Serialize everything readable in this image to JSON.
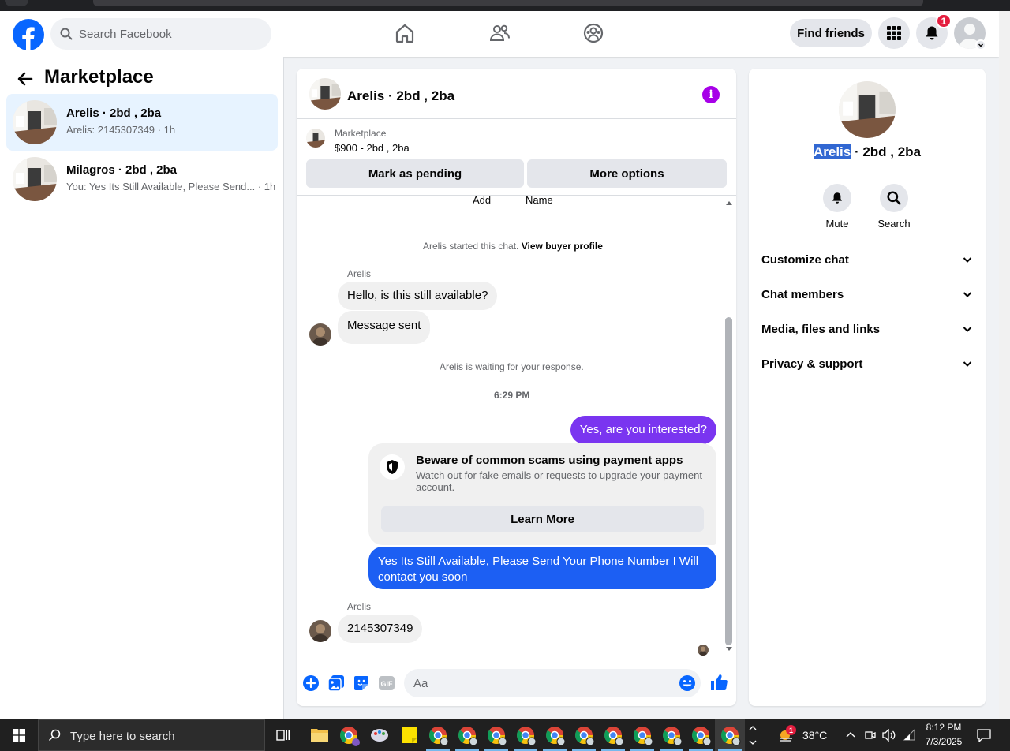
{
  "topnav": {
    "search_placeholder": "Search Facebook",
    "find_friends": "Find friends",
    "notification_count": "1"
  },
  "left_panel": {
    "title": "Marketplace",
    "conversations": [
      {
        "name": "Arelis · 2bd , 2ba",
        "snippet": "Arelis: 2145307349 · 1h",
        "active": true
      },
      {
        "name": "Milagros · 2bd , 2ba",
        "snippet": "You: Yes Its Still Available, Please Send... · 1h",
        "active": false
      }
    ]
  },
  "chat": {
    "title": "Arelis · 2bd , 2ba",
    "listing_label": "Marketplace",
    "listing_price": "$900 - 2bd , 2ba",
    "mark_pending": "Mark as pending",
    "more_options": "More options",
    "cut_labels": [
      "Add",
      "Name"
    ],
    "started_text": "Arelis started this chat.",
    "view_buyer": "View buyer profile",
    "sender_1": "Arelis",
    "msg_1": "Hello, is this still available?",
    "msg_2": "Message sent",
    "waiting_text": "Arelis is waiting for your response.",
    "timestamp": "6:29 PM",
    "out_1": "Yes, are you interested?",
    "scam_title": "Beware of common scams using payment apps",
    "scam_body": "Watch out for fake emails or requests to upgrade your payment account.",
    "learn_more": "Learn More",
    "out_2": "Yes Its Still Available, Please Send Your Phone Number I Will contact you soon",
    "sender_2": "Arelis",
    "msg_3": "2145307349",
    "composer_placeholder": "Aa"
  },
  "right_panel": {
    "name_highlight": "Arelis",
    "name_rest": " · 2bd , 2ba",
    "actions": {
      "mute": "Mute",
      "search": "Search"
    },
    "sections": [
      "Customize chat",
      "Chat members",
      "Media, files and links",
      "Privacy & support"
    ]
  },
  "taskbar": {
    "search_text": "Type here to search",
    "weather_badge": "1",
    "temperature": "38°C",
    "time": "8:12 PM",
    "date": "7/3/2025"
  },
  "colors": {
    "facebook_blue": "#0866ff",
    "outgoing_purple": "#7a35f0",
    "outgoing_blue": "#1c5ff3",
    "info_purple": "#a700e8",
    "badge_red": "#e41e3f",
    "active_row": "#e7f3ff"
  },
  "icons": [
    "facebook-logo-icon",
    "search-icon",
    "home-icon",
    "friends-icon",
    "groups-icon",
    "grid-menu-icon",
    "bell-icon",
    "back-arrow-icon",
    "info-icon",
    "shield-icon",
    "plus-circle-icon",
    "image-icon",
    "sticker-icon",
    "gif-icon",
    "emoji-icon",
    "thumbs-up-icon",
    "chevron-down-icon",
    "windows-start-icon",
    "task-view-icon"
  ]
}
